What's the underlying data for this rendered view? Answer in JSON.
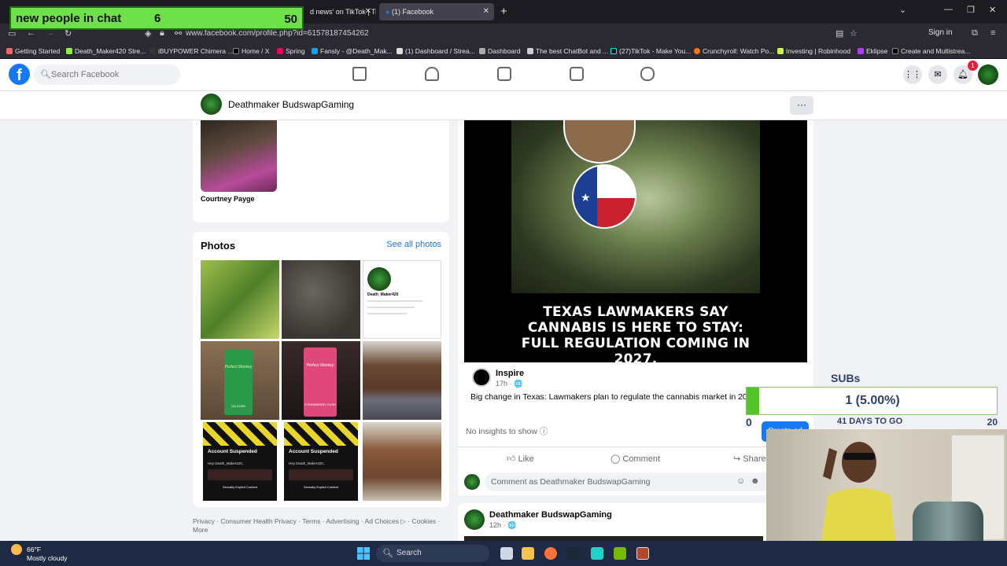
{
  "overlay_counter": {
    "label": "new people in chat",
    "current": "6",
    "goal": "50"
  },
  "browser": {
    "tabs": [
      {
        "label": "d news' on TikTok | Ti"
      },
      {
        "label": "(1) Facebook"
      }
    ],
    "url": "www.facebook.com/profile.php?id=61578187454262",
    "signin": "Sign in",
    "bookmarks": [
      "Getting Started",
      "Death_Maker420 Stre...",
      "iBUYPOWER Chimera ...",
      "Home / X",
      "Spring",
      "Fansly - @Death_Mak...",
      "(1) Dashboard / Strea...",
      "Dashboard",
      "The best ChatBot and ...",
      "(27)TikTok - Make You...",
      "Crunchyroll: Watch Po...",
      "Investing | Robinhood",
      "Eklipse",
      "Create and Multistrea..."
    ]
  },
  "facebook": {
    "search_placeholder": "Search Facebook",
    "notification_count": "1",
    "profile_name": "Deathmaker BudswapGaming",
    "friend_name": "Courtney Payge",
    "photos_title": "Photos",
    "see_all_photos": "See all photos",
    "photo_texts": {
      "profile_handle": "Death_Maker420",
      "suspended_title": "Account Suspended",
      "suspended_greeting": "Hey Death_Maker420,",
      "suspended_reason": "Sexually Explicit Content",
      "product_brand": "Perfect Monkey",
      "product_flavor_a": "OG KUSH",
      "product_flavor_b": "STRAWBERRY KUSH"
    },
    "footer": "Privacy · Consumer Health Privacy · Terms · Advertising · Ad Choices ▷ · Cookies · More",
    "post": {
      "headline": "TEXAS LAWMAKERS SAY CANNABIS IS HERE TO STAY: FULL REGULATION COMING IN 2027.",
      "source_name": "Inspire",
      "source_time": "17h · 🌐",
      "caption": "Big change in Texas: Lawmakers plan to regulate the cannabis market in 2027.",
      "no_insights": "No insights to show",
      "create_ad": "Create ad",
      "like": "Like",
      "comment": "Comment",
      "share": "Share",
      "comment_placeholder": "Comment as Deathmaker BudswapGaming"
    },
    "post2": {
      "name": "Deathmaker BudswapGaming",
      "time": "12h · 🌐"
    }
  },
  "subs_goal": {
    "title": "SUBs",
    "value_text": "1 (5.00%)",
    "progress": 0.05,
    "min": "0",
    "max": "20",
    "days_left": "41 DAYS TO GO"
  },
  "taskbar": {
    "temperature": "66°F",
    "condition": "Mostly cloudy",
    "search": "Search"
  },
  "colors": {
    "fb_blue": "#1877f2",
    "overlay_green": "#6ee04a",
    "subs_fill": "#55c42a"
  }
}
